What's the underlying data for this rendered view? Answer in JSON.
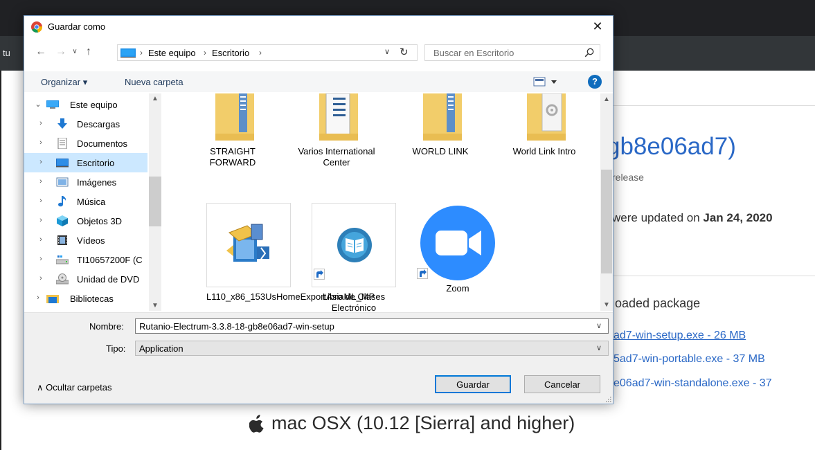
{
  "background": {
    "address_fragment": "tu",
    "release_title": "gb8e06ad7)",
    "release_sub": "release",
    "updated_text": "were updated on ",
    "updated_date": "Jan 24, 2020",
    "package_heading": "oaded package",
    "links": [
      "ad7-win-setup.exe - 26 MB",
      "5ad7-win-portable.exe - 37 MB",
      "e06ad7-win-standalone.exe - 37"
    ],
    "mac_heading": "mac OSX (10.12 [Sierra] and higher)"
  },
  "dialog": {
    "title": "Guardar como",
    "close": "✕",
    "address": {
      "parts": [
        "Este equipo",
        "Escritorio"
      ]
    },
    "search": {
      "placeholder": "Buscar en Escritorio"
    },
    "toolbar": {
      "organize": "Organizar ▾",
      "new_folder": "Nueva carpeta",
      "help": "?"
    },
    "nav": [
      {
        "label": "Este equipo",
        "icon": "pc-icon",
        "expanded": true
      },
      {
        "label": "Descargas",
        "icon": "download-icon"
      },
      {
        "label": "Documentos",
        "icon": "documents-icon"
      },
      {
        "label": "Escritorio",
        "icon": "desktop-icon",
        "selected": true
      },
      {
        "label": "Imágenes",
        "icon": "pictures-icon"
      },
      {
        "label": "Música",
        "icon": "music-icon"
      },
      {
        "label": "Objetos 3D",
        "icon": "objects3d-icon"
      },
      {
        "label": "Vídeos",
        "icon": "videos-icon"
      },
      {
        "label": "TI10657200F (C",
        "icon": "drive-icon"
      },
      {
        "label": "Unidad de DVD",
        "icon": "dvd-icon"
      },
      {
        "label": "Bibliotecas",
        "icon": "libraries-icon"
      }
    ],
    "files": [
      {
        "name": "STRAIGHT FORWARD",
        "type": "folder"
      },
      {
        "name": "Varios International Center",
        "type": "folder"
      },
      {
        "name": "WORLD LINK",
        "type": "folder"
      },
      {
        "name": "World Link Intro",
        "type": "folder"
      },
      {
        "name": "L110_x86_153UsHomeExportAsiaML_MP",
        "type": "installer"
      },
      {
        "name": "Libro de Clases Electrónico",
        "type": "shortcut"
      },
      {
        "name": "Zoom",
        "type": "shortcut"
      }
    ],
    "name_label": "Nombre:",
    "name_value": "Rutanio-Electrum-3.3.8-18-gb8e06ad7-win-setup",
    "type_label": "Tipo:",
    "type_value": "Application",
    "hide_folders": "Ocultar carpetas",
    "save": "Guardar",
    "cancel": "Cancelar"
  }
}
